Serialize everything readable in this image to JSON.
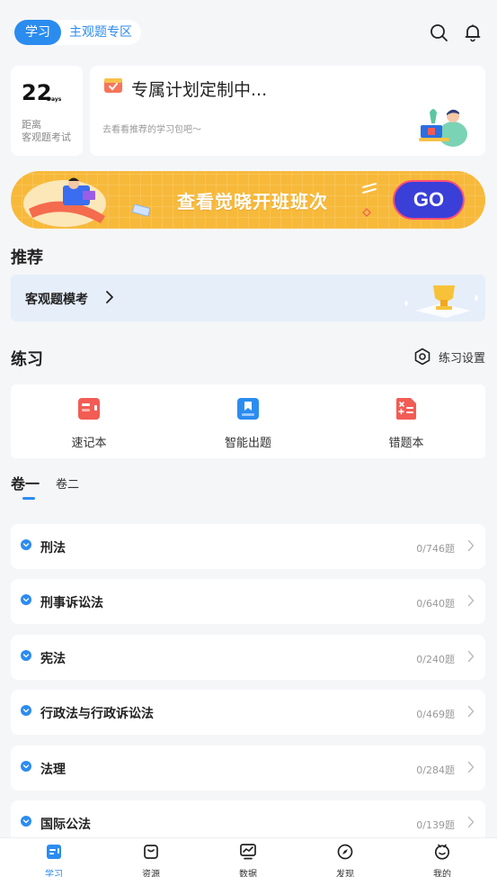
{
  "header": {
    "tab_active": "学习",
    "tab_inactive": "主观题专区"
  },
  "countdown": {
    "days": "22",
    "unit": "Days",
    "desc_line1": "距离",
    "desc_line2": "客观题考试"
  },
  "plan": {
    "title": "专属计划定制中...",
    "subtitle": "去看看推荐的学习包吧〜"
  },
  "banner": {
    "text": "查看觉晓开班班次",
    "go": "GO"
  },
  "recommend": {
    "heading": "推荐",
    "item_label": "客观题模考"
  },
  "practice": {
    "heading": "练习",
    "settings_label": "练习设置",
    "tools": [
      {
        "label": "速记本",
        "icon": "notebook-icon",
        "color": "#f25c54"
      },
      {
        "label": "智能出题",
        "icon": "bookmark-icon",
        "color": "#2b8cf0"
      },
      {
        "label": "错题本",
        "icon": "wrong-book-icon",
        "color": "#f25c54"
      }
    ]
  },
  "volumes": {
    "tab1": "卷一",
    "tab2": "卷二"
  },
  "subjects": [
    {
      "name": "刑法",
      "count": "0/746题"
    },
    {
      "name": "刑事诉讼法",
      "count": "0/640题"
    },
    {
      "name": "宪法",
      "count": "0/240题"
    },
    {
      "name": "行政法与行政诉讼法",
      "count": "0/469题"
    },
    {
      "name": "法理",
      "count": "0/284题"
    },
    {
      "name": "国际公法",
      "count": "0/139题"
    }
  ],
  "tabbar": [
    {
      "label": "学习",
      "icon": "study-icon"
    },
    {
      "label": "资源",
      "icon": "resource-icon"
    },
    {
      "label": "数据",
      "icon": "data-icon"
    },
    {
      "label": "发现",
      "icon": "discover-icon"
    },
    {
      "label": "我的",
      "icon": "profile-icon"
    }
  ],
  "colors": {
    "accent": "#2b8cf0",
    "banner": "#f7b93a",
    "go_button": "#3a3fd8"
  }
}
